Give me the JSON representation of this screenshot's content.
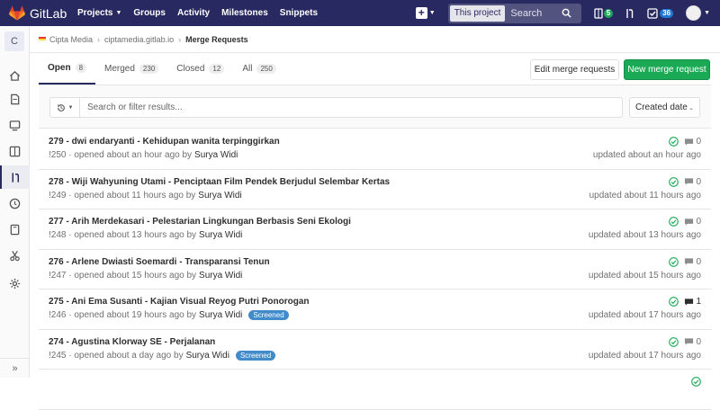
{
  "navbar": {
    "brand": "GitLab",
    "links": [
      "Projects",
      "Groups",
      "Activity",
      "Milestones",
      "Snippets"
    ],
    "search_scope": "This project",
    "search_placeholder": "Search",
    "issues_count": "5",
    "todos_count": "36"
  },
  "sidebar": {
    "project_initial": "C",
    "items": [
      "project-icon",
      "repository-icon",
      "registry-icon",
      "issues-icon",
      "merge-requests-icon",
      "ci-cd-icon",
      "wiki-icon",
      "snippets-icon",
      "settings-icon"
    ],
    "collapse": "»"
  },
  "breadcrumb": {
    "group": "Cipta Media",
    "project": "ciptamedia.gitlab.io",
    "current": "Merge Requests"
  },
  "tabs": [
    {
      "label": "Open",
      "count": "8"
    },
    {
      "label": "Merged",
      "count": "230"
    },
    {
      "label": "Closed",
      "count": "12"
    },
    {
      "label": "All",
      "count": "250"
    }
  ],
  "buttons": {
    "edit": "Edit merge requests",
    "new": "New merge request"
  },
  "filter": {
    "placeholder": "Search or filter results...",
    "sort": "Created date"
  },
  "merge_requests": [
    {
      "title": "279 - dwi endaryanti - Kehidupan wanita terpinggirkan",
      "ref": "!250",
      "opened": "· opened about an hour ago by",
      "author": "Surya Widi",
      "label": "",
      "comments": "0",
      "updated": "updated about an hour ago"
    },
    {
      "title": "278 - Wiji Wahyuning Utami - Penciptaan Film Pendek Berjudul Selembar Kertas",
      "ref": "!249",
      "opened": "· opened about 11 hours ago by",
      "author": "Surya Widi",
      "label": "",
      "comments": "0",
      "updated": "updated about 11 hours ago"
    },
    {
      "title": "277 - Arih Merdekasari - Pelestarian Lingkungan Berbasis Seni Ekologi",
      "ref": "!248",
      "opened": "· opened about 13 hours ago by",
      "author": "Surya Widi",
      "label": "",
      "comments": "0",
      "updated": "updated about 13 hours ago"
    },
    {
      "title": "276 - Arlene Dwiasti Soemardi - Transparansi Tenun",
      "ref": "!247",
      "opened": "· opened about 15 hours ago by",
      "author": "Surya Widi",
      "label": "",
      "comments": "0",
      "updated": "updated about 15 hours ago"
    },
    {
      "title": "275 - Ani Ema Susanti - Kajian Visual Reyog Putri Ponorogan",
      "ref": "!246",
      "opened": "· opened about 19 hours ago by",
      "author": "Surya Widi",
      "label": "Screened",
      "comments": "1",
      "updated": "updated about 17 hours ago"
    },
    {
      "title": "274 - Agustina Klorway SE - Perjalanan",
      "ref": "!245",
      "opened": "· opened about a day ago by",
      "author": "Surya Widi",
      "label": "Screened",
      "comments": "0",
      "updated": "updated about 17 hours ago"
    },
    {
      "title": "",
      "ref": "",
      "opened": "",
      "author": "",
      "label": "",
      "comments": "",
      "updated": ""
    }
  ],
  "colors": {
    "navbar": "#292961",
    "accent_green": "#1aaa55",
    "label_blue": "#428bca"
  }
}
